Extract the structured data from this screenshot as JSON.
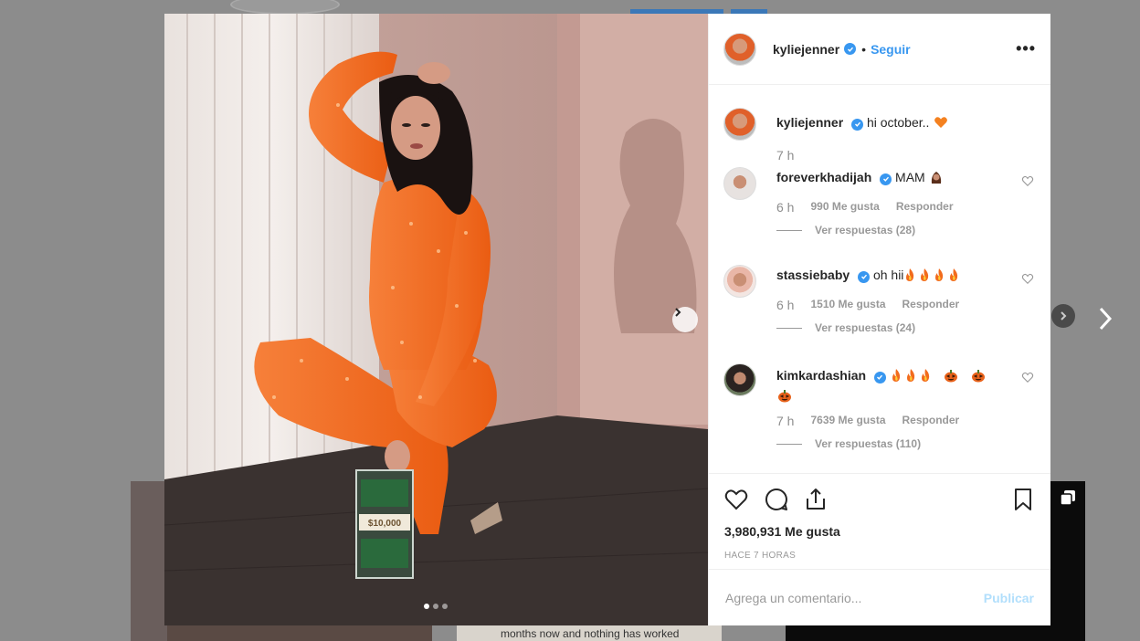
{
  "post": {
    "author": "kyliejenner",
    "separator": "•",
    "follow_label": "Seguir",
    "more_label": "•••",
    "caption": "hi october..",
    "caption_time": "7 h",
    "money_label": "$10,000",
    "photo_dots": 3,
    "photo_active_dot": 0
  },
  "comments": [
    {
      "user": "foreverkhadijah",
      "text": "MAM",
      "emoji": [
        "woman-icon"
      ],
      "time": "6 h",
      "likes": "990 Me gusta",
      "reply": "Responder",
      "replies": "Ver respuestas (28)"
    },
    {
      "user": "stassiebaby",
      "text": "oh hii",
      "emoji": [
        "fire-icon",
        "fire-icon",
        "fire-icon",
        "fire-icon"
      ],
      "time": "6 h",
      "likes": "1510 Me gusta",
      "reply": "Responder",
      "replies": "Ver respuestas (24)"
    },
    {
      "user": "kimkardashian",
      "text": "",
      "emoji": [
        "fire-icon",
        "fire-icon",
        "fire-icon",
        "pumpkin-icon",
        "pumpkin-icon",
        "pumpkin-icon"
      ],
      "time": "7 h",
      "likes": "7639 Me gusta",
      "reply": "Responder",
      "replies": "Ver respuestas (110)"
    }
  ],
  "footer": {
    "likes": "3,980,931 Me gusta",
    "time_ago": "HACE 7 HORAS",
    "comment_placeholder": "Agrega un comentario...",
    "publish_label": "Publicar"
  },
  "background": {
    "text_fragment": "months now and nothing has worked"
  },
  "colors": {
    "accent": "#3897f0",
    "publish_disabled": "#b2dffc",
    "jumpsuit": "#f06a1e"
  }
}
